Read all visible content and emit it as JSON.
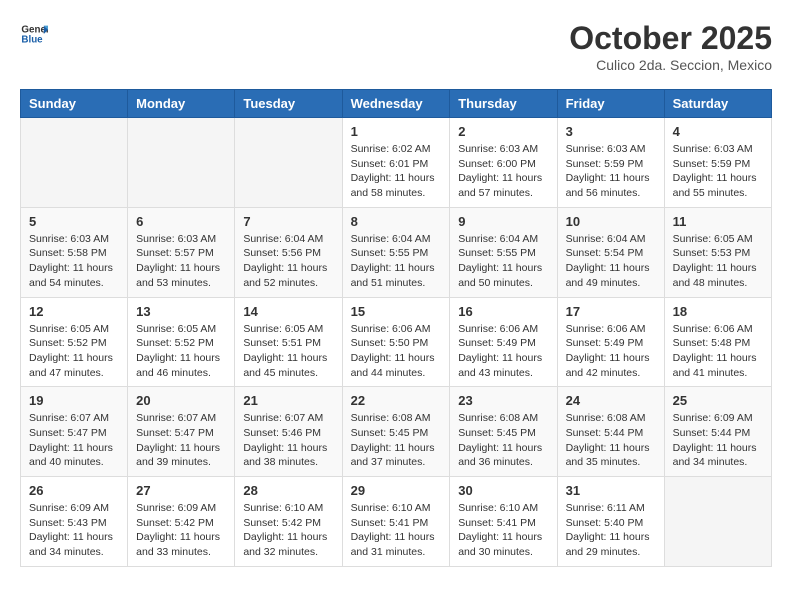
{
  "header": {
    "logo_line1": "General",
    "logo_line2": "Blue",
    "month": "October 2025",
    "location": "Culico 2da. Seccion, Mexico"
  },
  "weekdays": [
    "Sunday",
    "Monday",
    "Tuesday",
    "Wednesday",
    "Thursday",
    "Friday",
    "Saturday"
  ],
  "weeks": [
    [
      {
        "day": "",
        "info": ""
      },
      {
        "day": "",
        "info": ""
      },
      {
        "day": "",
        "info": ""
      },
      {
        "day": "1",
        "info": "Sunrise: 6:02 AM\nSunset: 6:01 PM\nDaylight: 11 hours\nand 58 minutes."
      },
      {
        "day": "2",
        "info": "Sunrise: 6:03 AM\nSunset: 6:00 PM\nDaylight: 11 hours\nand 57 minutes."
      },
      {
        "day": "3",
        "info": "Sunrise: 6:03 AM\nSunset: 5:59 PM\nDaylight: 11 hours\nand 56 minutes."
      },
      {
        "day": "4",
        "info": "Sunrise: 6:03 AM\nSunset: 5:59 PM\nDaylight: 11 hours\nand 55 minutes."
      }
    ],
    [
      {
        "day": "5",
        "info": "Sunrise: 6:03 AM\nSunset: 5:58 PM\nDaylight: 11 hours\nand 54 minutes."
      },
      {
        "day": "6",
        "info": "Sunrise: 6:03 AM\nSunset: 5:57 PM\nDaylight: 11 hours\nand 53 minutes."
      },
      {
        "day": "7",
        "info": "Sunrise: 6:04 AM\nSunset: 5:56 PM\nDaylight: 11 hours\nand 52 minutes."
      },
      {
        "day": "8",
        "info": "Sunrise: 6:04 AM\nSunset: 5:55 PM\nDaylight: 11 hours\nand 51 minutes."
      },
      {
        "day": "9",
        "info": "Sunrise: 6:04 AM\nSunset: 5:55 PM\nDaylight: 11 hours\nand 50 minutes."
      },
      {
        "day": "10",
        "info": "Sunrise: 6:04 AM\nSunset: 5:54 PM\nDaylight: 11 hours\nand 49 minutes."
      },
      {
        "day": "11",
        "info": "Sunrise: 6:05 AM\nSunset: 5:53 PM\nDaylight: 11 hours\nand 48 minutes."
      }
    ],
    [
      {
        "day": "12",
        "info": "Sunrise: 6:05 AM\nSunset: 5:52 PM\nDaylight: 11 hours\nand 47 minutes."
      },
      {
        "day": "13",
        "info": "Sunrise: 6:05 AM\nSunset: 5:52 PM\nDaylight: 11 hours\nand 46 minutes."
      },
      {
        "day": "14",
        "info": "Sunrise: 6:05 AM\nSunset: 5:51 PM\nDaylight: 11 hours\nand 45 minutes."
      },
      {
        "day": "15",
        "info": "Sunrise: 6:06 AM\nSunset: 5:50 PM\nDaylight: 11 hours\nand 44 minutes."
      },
      {
        "day": "16",
        "info": "Sunrise: 6:06 AM\nSunset: 5:49 PM\nDaylight: 11 hours\nand 43 minutes."
      },
      {
        "day": "17",
        "info": "Sunrise: 6:06 AM\nSunset: 5:49 PM\nDaylight: 11 hours\nand 42 minutes."
      },
      {
        "day": "18",
        "info": "Sunrise: 6:06 AM\nSunset: 5:48 PM\nDaylight: 11 hours\nand 41 minutes."
      }
    ],
    [
      {
        "day": "19",
        "info": "Sunrise: 6:07 AM\nSunset: 5:47 PM\nDaylight: 11 hours\nand 40 minutes."
      },
      {
        "day": "20",
        "info": "Sunrise: 6:07 AM\nSunset: 5:47 PM\nDaylight: 11 hours\nand 39 minutes."
      },
      {
        "day": "21",
        "info": "Sunrise: 6:07 AM\nSunset: 5:46 PM\nDaylight: 11 hours\nand 38 minutes."
      },
      {
        "day": "22",
        "info": "Sunrise: 6:08 AM\nSunset: 5:45 PM\nDaylight: 11 hours\nand 37 minutes."
      },
      {
        "day": "23",
        "info": "Sunrise: 6:08 AM\nSunset: 5:45 PM\nDaylight: 11 hours\nand 36 minutes."
      },
      {
        "day": "24",
        "info": "Sunrise: 6:08 AM\nSunset: 5:44 PM\nDaylight: 11 hours\nand 35 minutes."
      },
      {
        "day": "25",
        "info": "Sunrise: 6:09 AM\nSunset: 5:44 PM\nDaylight: 11 hours\nand 34 minutes."
      }
    ],
    [
      {
        "day": "26",
        "info": "Sunrise: 6:09 AM\nSunset: 5:43 PM\nDaylight: 11 hours\nand 34 minutes."
      },
      {
        "day": "27",
        "info": "Sunrise: 6:09 AM\nSunset: 5:42 PM\nDaylight: 11 hours\nand 33 minutes."
      },
      {
        "day": "28",
        "info": "Sunrise: 6:10 AM\nSunset: 5:42 PM\nDaylight: 11 hours\nand 32 minutes."
      },
      {
        "day": "29",
        "info": "Sunrise: 6:10 AM\nSunset: 5:41 PM\nDaylight: 11 hours\nand 31 minutes."
      },
      {
        "day": "30",
        "info": "Sunrise: 6:10 AM\nSunset: 5:41 PM\nDaylight: 11 hours\nand 30 minutes."
      },
      {
        "day": "31",
        "info": "Sunrise: 6:11 AM\nSunset: 5:40 PM\nDaylight: 11 hours\nand 29 minutes."
      },
      {
        "day": "",
        "info": ""
      }
    ]
  ]
}
